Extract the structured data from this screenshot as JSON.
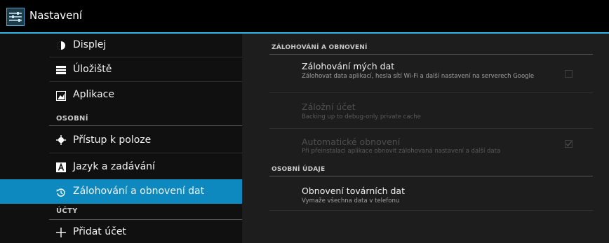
{
  "actionbar": {
    "title": "Nastavení",
    "icon": "settings-sliders-icon",
    "accent": "#33b5e5"
  },
  "sidebar": {
    "items": [
      {
        "label": "Displej",
        "icon": "display-icon"
      },
      {
        "label": "Úložiště",
        "icon": "storage-icon"
      },
      {
        "label": "Aplikace",
        "icon": "apps-icon"
      },
      {
        "section": "OSOBNÍ"
      },
      {
        "label": "Přístup k poloze",
        "icon": "location-icon"
      },
      {
        "label": "Jazyk a zadávání",
        "icon": "language-icon"
      },
      {
        "label": "Zálohování a obnovení dat",
        "icon": "backup-icon",
        "selected": true
      },
      {
        "section": "ÚČTY"
      },
      {
        "label": "Přidat účet",
        "icon": "add-icon"
      }
    ],
    "selected_color": "#0d89bf"
  },
  "main": {
    "section1": "ZÁLOHOVÁNÍ A OBNOVENÍ",
    "backup": {
      "title": "Zálohování mých dat",
      "summary": "Zálohovat data aplikací, hesla sítí Wi-Fi a další nastavení na serverech Google",
      "checked": false
    },
    "account": {
      "title": "Záložní účet",
      "summary": "Backing up to debug-only private cache",
      "enabled": false
    },
    "autorestore": {
      "title": "Automatické obnovení",
      "summary": "Při přeinstalaci aplikace obnovit zálohovaná nastavení a další data",
      "checked": true,
      "enabled": false
    },
    "section2": "OSOBNÍ ÚDAJE",
    "factory": {
      "title": "Obnovení továrních dat",
      "summary": "Vymaže všechna data v telefonu"
    }
  }
}
